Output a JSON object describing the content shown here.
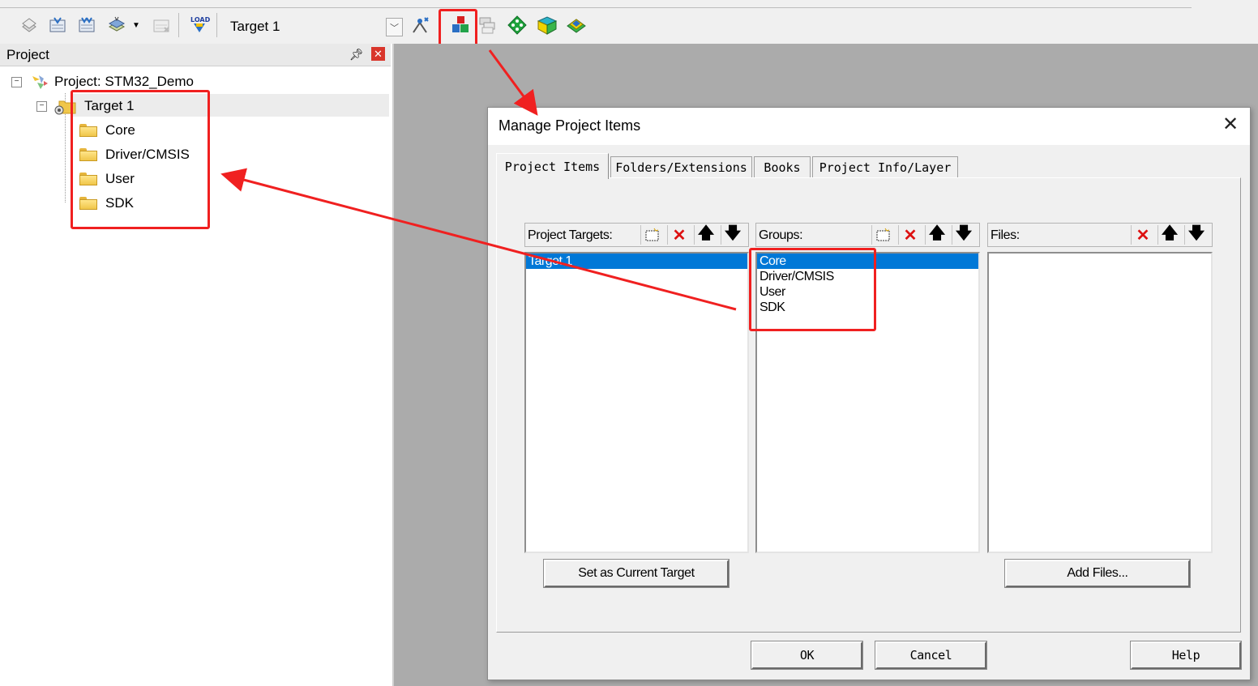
{
  "toolbar": {
    "target_combo_value": "Target 1",
    "buttons": [
      {
        "icon": "translate-icon"
      },
      {
        "icon": "build-icon"
      },
      {
        "icon": "rebuild-icon"
      },
      {
        "icon": "batch-build-icon"
      },
      {
        "icon": "stop-build-icon"
      },
      {
        "icon": "load-icon",
        "text": "LOAD"
      },
      {
        "icon": "options-for-target-icon"
      },
      {
        "icon": "manage-project-items-icon"
      },
      {
        "icon": "select-software-packs-icon"
      },
      {
        "icon": "manage-run-time-environment-icon"
      },
      {
        "icon": "pack-installer-icon"
      },
      {
        "icon": "layers-icon"
      }
    ]
  },
  "project_pane": {
    "title": "Project",
    "root_label": "Project: STM32_Demo",
    "target_label": "Target 1",
    "groups": [
      "Core",
      "Driver/CMSIS",
      "User",
      "SDK"
    ]
  },
  "dialog": {
    "title": "Manage Project Items",
    "tabs": [
      "Project Items",
      "Folders/Extensions",
      "Books",
      "Project Info/Layer"
    ],
    "active_tab": "Project Items",
    "targets_label": "Project Targets:",
    "targets": [
      "Target 1"
    ],
    "groups_label": "Groups:",
    "groups": [
      "Core",
      "Driver/CMSIS",
      "User",
      "SDK"
    ],
    "files_label": "Files:",
    "set_current_target_button": "Set as Current Target",
    "add_files_button": "Add Files...",
    "ok_button": "OK",
    "cancel_button": "Cancel",
    "help_button": "Help"
  },
  "annotation_color": "#f02020",
  "selection_color": "#0078d7"
}
